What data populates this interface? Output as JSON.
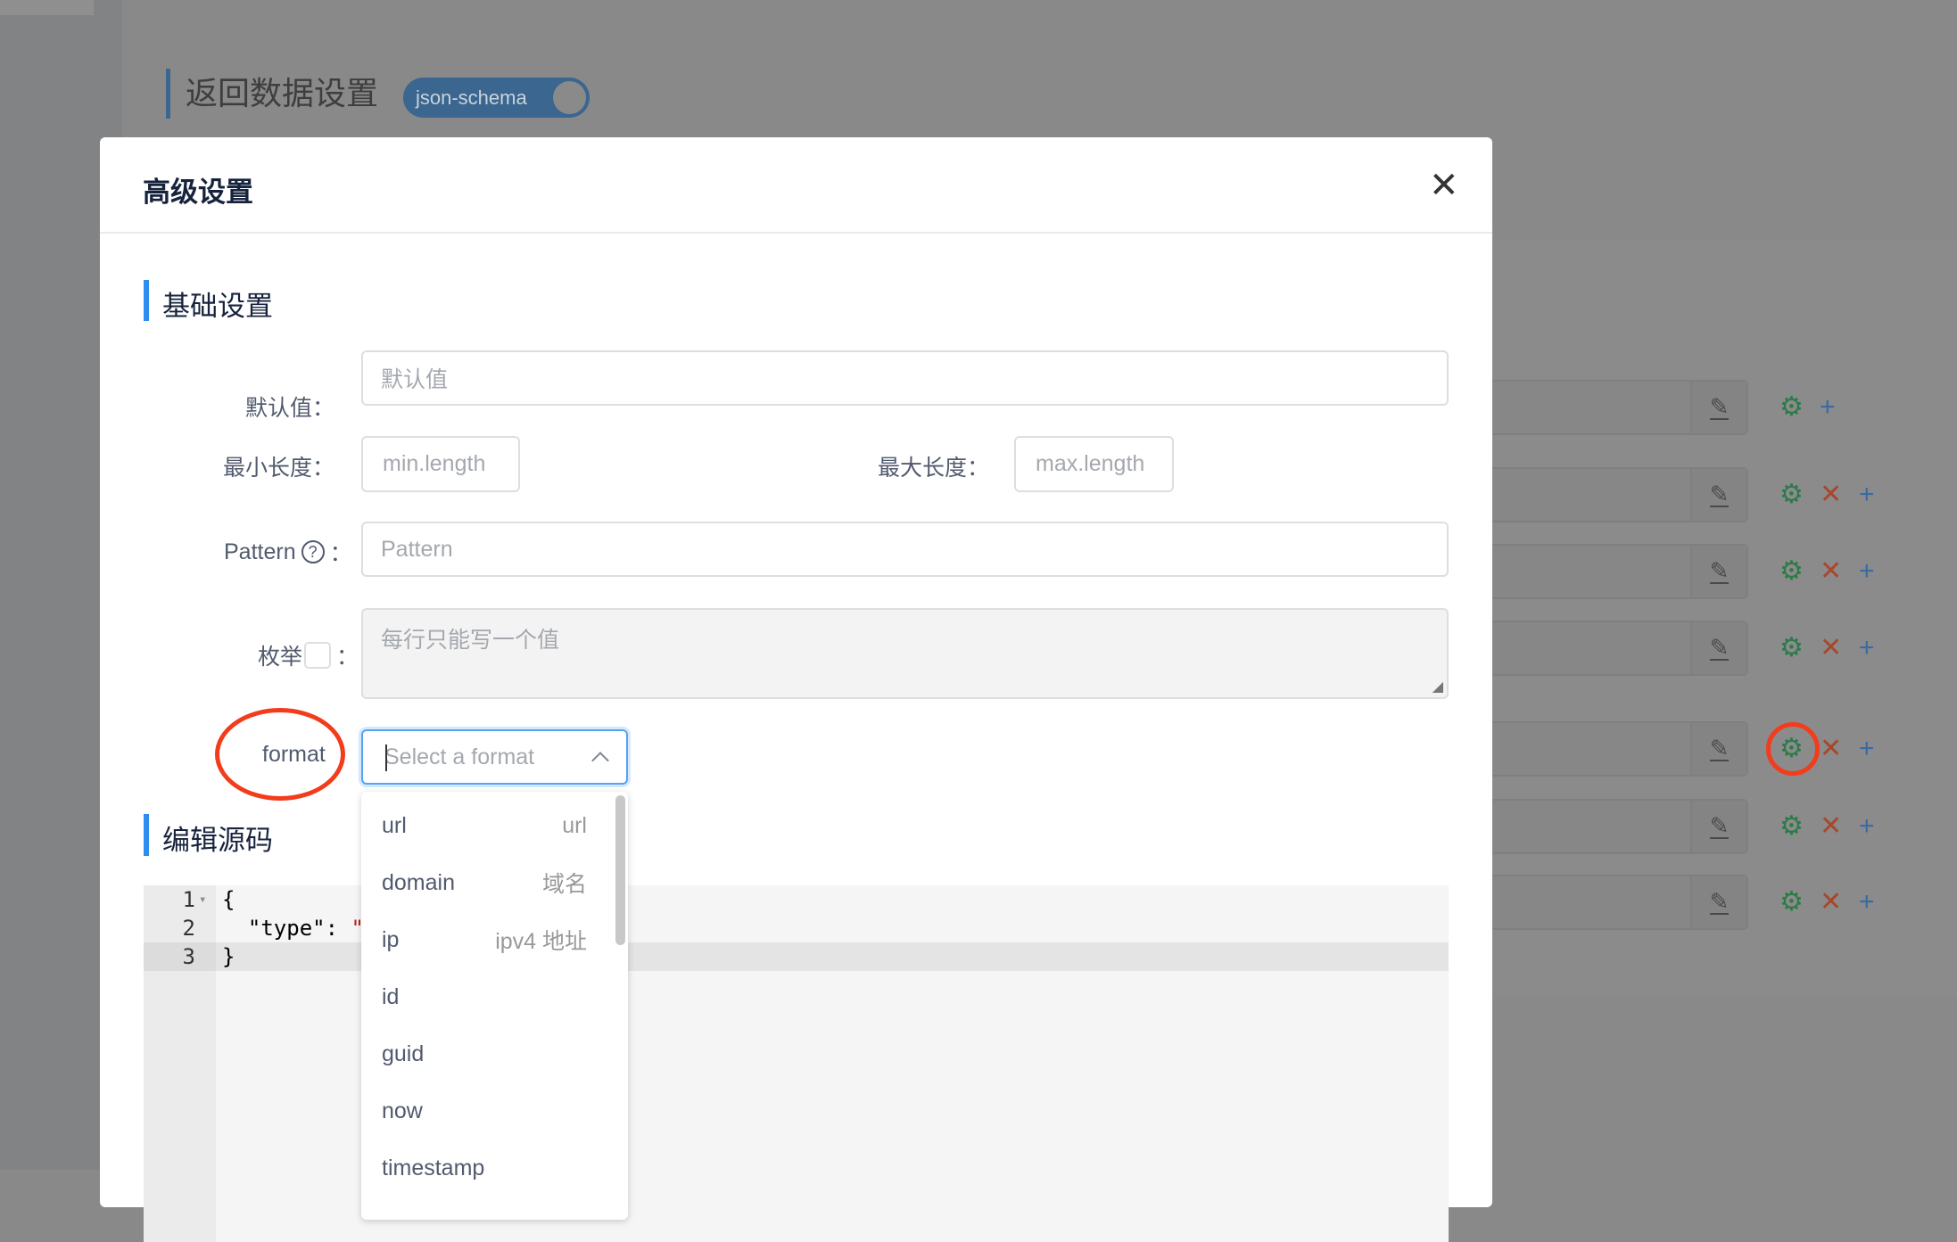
{
  "background": {
    "section_title": "返回数据设置",
    "toggle_label": "json-schema",
    "rows": [
      {
        "has_delete": false
      },
      {
        "has_delete": true
      },
      {
        "has_delete": true
      },
      {
        "has_delete": true
      },
      {
        "has_delete": true
      },
      {
        "has_delete": true
      },
      {
        "has_delete": true
      }
    ]
  },
  "modal": {
    "title": "高级设置",
    "close_icon": "close-icon",
    "basic_section": "基础设置",
    "fields": {
      "default_label": "默认值：",
      "default_placeholder": "默认值",
      "min_label": "最小长度：",
      "min_placeholder": "min.length",
      "max_label": "最大长度：",
      "max_placeholder": "max.length",
      "pattern_label": "Pattern",
      "pattern_colon": "：",
      "pattern_placeholder": "Pattern",
      "enum_label": "枚举",
      "enum_colon": "：",
      "enum_placeholder": "每行只能写一个值",
      "format_label": "format",
      "format_placeholder": "Select a format"
    },
    "format_options": [
      {
        "value": "url",
        "desc": "url"
      },
      {
        "value": "domain",
        "desc": "域名"
      },
      {
        "value": "ip",
        "desc": "ipv4 地址"
      },
      {
        "value": "id",
        "desc": ""
      },
      {
        "value": "guid",
        "desc": ""
      },
      {
        "value": "now",
        "desc": ""
      },
      {
        "value": "timestamp",
        "desc": ""
      }
    ],
    "source_section": "编辑源码",
    "code_lines": [
      {
        "n": "1",
        "text": "{"
      },
      {
        "n": "2",
        "text": "  \"type\": \""
      },
      {
        "n": "3",
        "text": "}"
      }
    ]
  },
  "colors": {
    "accent": "#2d8cf0",
    "annotation": "#f23c1c",
    "gear": "#2c7a4a",
    "delete": "#a8472b",
    "add": "#3a6aa3"
  }
}
